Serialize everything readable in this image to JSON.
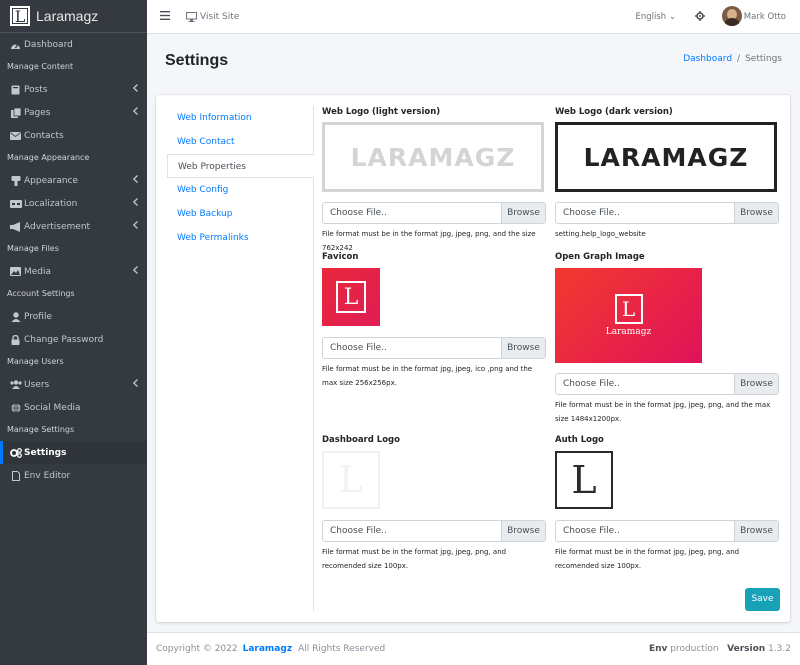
{
  "app": {
    "name": "Laramagz",
    "logo_letter": "L"
  },
  "sidebar": {
    "items": [
      {
        "type": "item",
        "label": "Dashboard",
        "icon": "tachometer-icon"
      },
      {
        "type": "header",
        "label": "Manage Content"
      },
      {
        "type": "item",
        "label": "Posts",
        "icon": "book-icon",
        "caret": true
      },
      {
        "type": "item",
        "label": "Pages",
        "icon": "copy-icon",
        "caret": true
      },
      {
        "type": "item",
        "label": "Contacts",
        "icon": "envelope-icon"
      },
      {
        "type": "header",
        "label": "Manage Appearance"
      },
      {
        "type": "item",
        "label": "Appearance",
        "icon": "paint-brush-icon",
        "caret": true
      },
      {
        "type": "item",
        "label": "Localization",
        "icon": "language-icon",
        "caret": true
      },
      {
        "type": "item",
        "label": "Advertisement",
        "icon": "bullhorn-icon",
        "caret": true
      },
      {
        "type": "header",
        "label": "Manage Files"
      },
      {
        "type": "item",
        "label": "Media",
        "icon": "photo-icon",
        "caret": true
      },
      {
        "type": "header",
        "label": "Account Settings"
      },
      {
        "type": "item",
        "label": "Profile",
        "icon": "user-icon"
      },
      {
        "type": "item",
        "label": "Change Password",
        "icon": "lock-icon"
      },
      {
        "type": "header",
        "label": "Manage Users"
      },
      {
        "type": "item",
        "label": "Users",
        "icon": "users-icon",
        "caret": true
      },
      {
        "type": "item",
        "label": "Social Media",
        "icon": "globe-icon"
      },
      {
        "type": "header",
        "label": "Manage Settings"
      },
      {
        "type": "item",
        "label": "Settings",
        "icon": "cogs-icon",
        "active": true
      },
      {
        "type": "item",
        "label": "Env Editor",
        "icon": "file-icon"
      }
    ]
  },
  "topbar": {
    "visit_site": "Visit Site",
    "language": "English",
    "username": "Mark Otto"
  },
  "page": {
    "title": "Settings",
    "breadcrumb": {
      "home": "Dashboard",
      "current": "Settings"
    }
  },
  "tabs": [
    {
      "label": "Web Information",
      "active": false
    },
    {
      "label": "Web Contact",
      "active": false
    },
    {
      "label": "Web Properties",
      "active": true
    },
    {
      "label": "Web Config",
      "active": false
    },
    {
      "label": "Web Backup",
      "active": false
    },
    {
      "label": "Web Permalinks",
      "active": false
    }
  ],
  "form": {
    "file_placeholder": "Choose File..",
    "browse": "Browse",
    "logo_light": {
      "label": "Web Logo (light version)",
      "preview_text": "LARAMAGZ",
      "help": "File format must be in the format jpg, jpeg, png, and the size 762x242"
    },
    "logo_dark": {
      "label": "Web Logo (dark version)",
      "preview_text": "LARAMAGZ",
      "help": "setting.help_logo_website"
    },
    "favicon": {
      "label": "Favicon",
      "help": "File format must be in the format jpg, jpeg, ico ,png and the max size 256x256px."
    },
    "og_image": {
      "label": "Open Graph Image",
      "preview_text": "Laramagz",
      "help": "File format must be in the format jpg, jpeg, png, and the max size 1484x1200px."
    },
    "dashboard_logo": {
      "label": "Dashboard Logo",
      "help": "File format must be in the format jpg, jpeg, png, and recomended size 100px."
    },
    "auth_logo": {
      "label": "Auth Logo",
      "help": "File format must be in the format jpg, jpeg, png, and recomended size 100px."
    },
    "save": "Save"
  },
  "footer": {
    "copyright": "Copyright © 2022",
    "brand": "Laramagz",
    "rights": "All Rights Reserved",
    "env_label": "Env",
    "env_value": "production",
    "version_label": "Version",
    "version_value": "1.3.2"
  },
  "colors": {
    "sidebar_bg": "#343a40",
    "accent": "#007bff",
    "save_button": "#17a2b8",
    "brand_red": "#e8283a"
  }
}
